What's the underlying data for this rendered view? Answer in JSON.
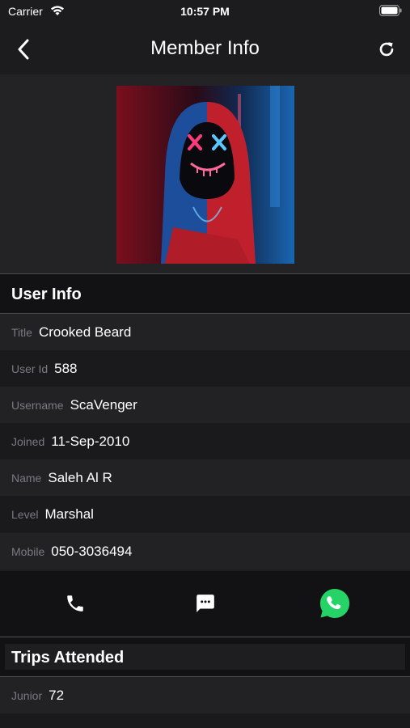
{
  "status_bar": {
    "carrier": "Carrier",
    "time": "10:57 PM"
  },
  "nav": {
    "title": "Member Info",
    "back_icon": "chevron-left-icon",
    "refresh_icon": "refresh-icon"
  },
  "user_info": {
    "header": "User Info",
    "rows": [
      {
        "key": "Title",
        "value": "Crooked Beard"
      },
      {
        "key": "User Id",
        "value": "588"
      },
      {
        "key": "Username",
        "value": "ScaVenger"
      },
      {
        "key": "Joined",
        "value": "11-Sep-2010"
      },
      {
        "key": "Name",
        "value": "Saleh Al R"
      },
      {
        "key": "Level",
        "value": "Marshal"
      },
      {
        "key": "Mobile",
        "value": "050-3036494"
      }
    ]
  },
  "actions": {
    "call_icon": "phone-icon",
    "message_icon": "message-icon",
    "whatsapp_icon": "whatsapp-icon",
    "whatsapp_color": "#25d366"
  },
  "trips": {
    "header": "Trips Attended",
    "rows": [
      {
        "key": "Junior",
        "value": "72"
      }
    ]
  }
}
